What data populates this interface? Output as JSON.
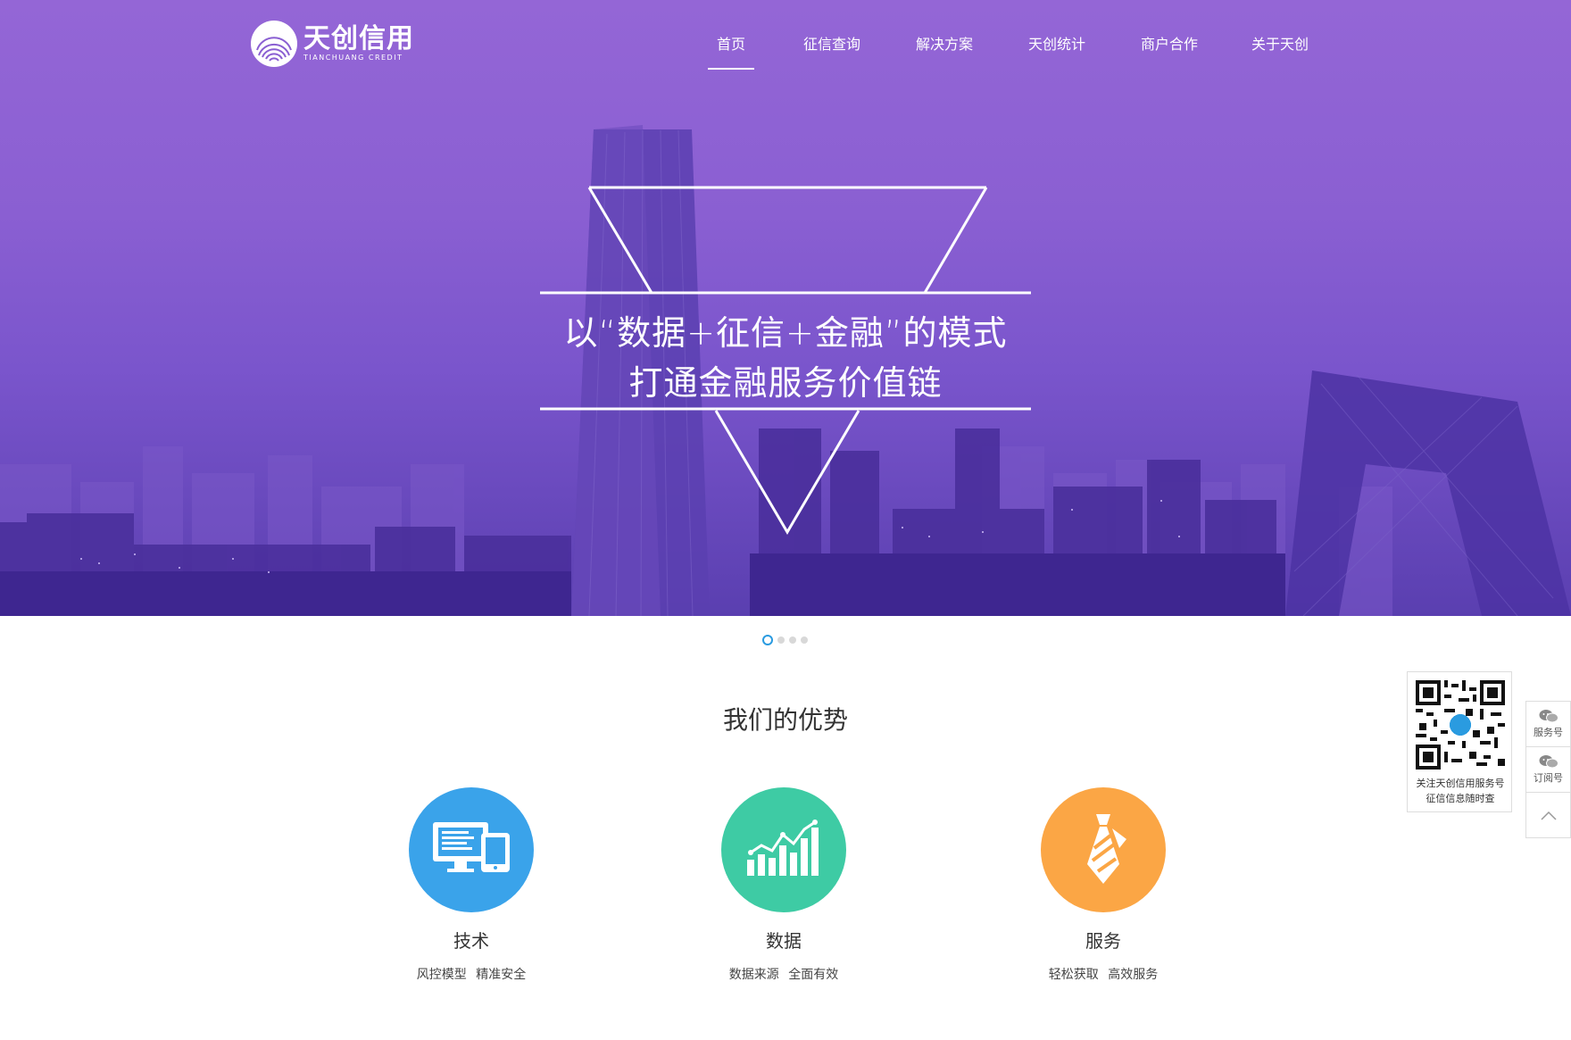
{
  "logo": {
    "name_cn": "天创信用",
    "name_en": "TIANCHUANG CREDIT"
  },
  "nav": [
    {
      "label": "首页",
      "active": true
    },
    {
      "label": "征信查询"
    },
    {
      "label": "解决方案"
    },
    {
      "label": "天创统计"
    },
    {
      "label": "商户合作"
    },
    {
      "label": "关于天创"
    }
  ],
  "hero": {
    "line1": "以“数据+征信+金融”的模式",
    "line2": "打通金融服务价值链",
    "slides_total": 4,
    "active_slide": 1
  },
  "advantages": {
    "title": "我们的优势",
    "items": [
      {
        "title": "技术",
        "desc": "风控模型 精准安全",
        "icon": "computer-tablet-icon",
        "color": "#3aa3ea"
      },
      {
        "title": "数据",
        "desc": "数据来源 全面有效",
        "icon": "chart-icon",
        "color": "#3ecba4"
      },
      {
        "title": "服务",
        "desc": "轻松获取 高效服务",
        "icon": "necktie-icon",
        "color": "#fba645"
      }
    ]
  },
  "sidebar": {
    "qr_caption_1": "关注天创信用服务号",
    "qr_caption_2": "征信信息随时查",
    "service_label": "服务号",
    "subscribe_label": "订阅号"
  },
  "colors": {
    "hero_purple": "#8a5fd2",
    "dot_active": "#2a9be0"
  }
}
